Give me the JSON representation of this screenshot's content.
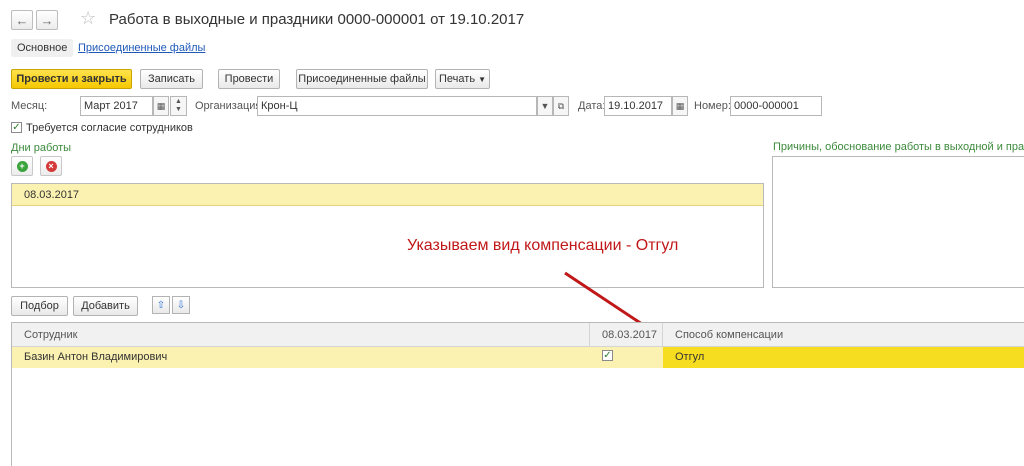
{
  "window": {
    "title": "Работа в выходные и праздники 0000-000001 от 19.10.2017",
    "back_icon": "arrow-left-icon",
    "forward_icon": "arrow-right-icon",
    "star_icon": "star-icon"
  },
  "tabs": [
    {
      "label": "Основное"
    },
    {
      "label": "Присоединенные файлы"
    }
  ],
  "toolbar": {
    "post_close": "Провести и закрыть",
    "save": "Записать",
    "post": "Провести",
    "attached": "Присоединенные файлы",
    "print": "Печать"
  },
  "form": {
    "month_label": "Месяц:",
    "month_value": "Март 2017",
    "org_label": "Организация:",
    "org_value": "Крон-Ц",
    "date_label": "Дата:",
    "date_value": "19.10.2017",
    "number_label": "Номер:",
    "number_value": "0000-000001",
    "consent_label": "Требуется согласие сотрудников",
    "consent_checked": true
  },
  "days": {
    "title": "Дни работы",
    "items": [
      "08.03.2017"
    ]
  },
  "reasons": {
    "title": "Причины, обоснование работы в выходной и праздничн"
  },
  "annotation": {
    "text": "Указываем вид компенсации - Отгул",
    "color": "#c01818"
  },
  "employees": {
    "pick_button": "Подбор",
    "add_button": "Добавить",
    "columns": [
      "Сотрудник",
      "08.03.2017",
      "Способ компенсации"
    ],
    "rows": [
      {
        "name": "Базин Антон Владимирович",
        "checked": true,
        "compensation": "Отгул"
      }
    ]
  },
  "colors": {
    "accent_yellow": "#f5c800",
    "row_selected": "#fbf1b0",
    "link_blue": "#1e59b8",
    "section_green": "#3b8a3b"
  }
}
